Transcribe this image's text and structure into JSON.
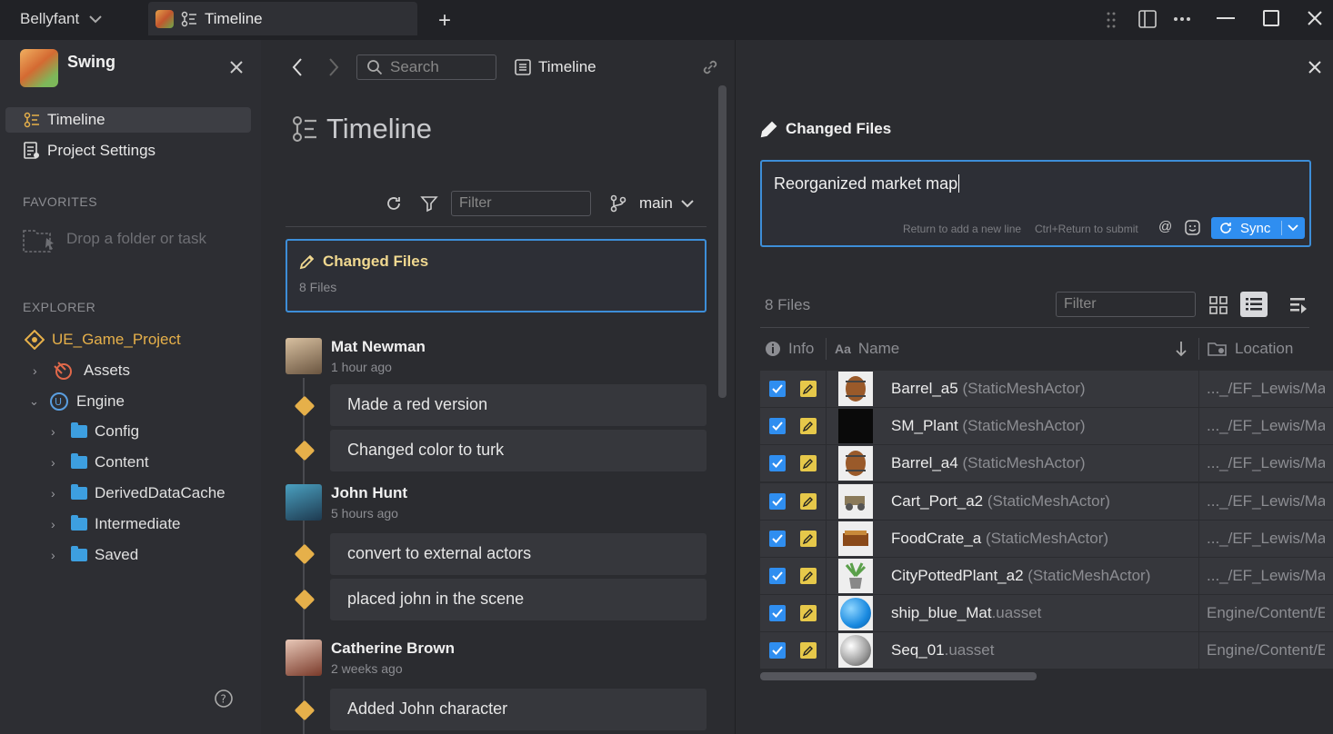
{
  "titlebar": {
    "workspace": "Bellyfant",
    "tab": "Timeline"
  },
  "sidebar": {
    "project": "Swing",
    "nav": [
      {
        "label": "Timeline"
      },
      {
        "label": "Project Settings"
      }
    ],
    "favorites_header": "FAVORITES",
    "favorites_drop": "Drop a folder or task",
    "explorer_header": "EXPLORER",
    "tree": {
      "root": "UE_Game_Project",
      "assets": "Assets",
      "engine": "Engine",
      "folders": [
        "Config",
        "Content",
        "DerivedDataCache",
        "Intermediate",
        "Saved"
      ]
    }
  },
  "middle": {
    "search_placeholder": "Search",
    "breadcrumb": "Timeline",
    "title": "Timeline",
    "filter_placeholder": "Filter",
    "branch": "main",
    "changed": {
      "title": "Changed Files",
      "count": "8 Files"
    },
    "authors": [
      {
        "name": "Mat Newman",
        "time": "1 hour ago",
        "commits": [
          "Made a red version",
          "Changed color to turk"
        ]
      },
      {
        "name": "John Hunt",
        "time": "5 hours ago",
        "commits": [
          "convert to external actors",
          "placed john in the scene"
        ]
      },
      {
        "name": "Catherine Brown",
        "time": "2 weeks ago",
        "commits": [
          "Added John character"
        ]
      }
    ]
  },
  "right": {
    "title": "Changed Files",
    "message": "Reorganized market map",
    "hint_newline": "Return to add a new line",
    "hint_submit": "Ctrl+Return to submit",
    "sync_label": "Sync",
    "files_count": "8 Files",
    "filter_placeholder": "Filter",
    "columns": {
      "info": "Info",
      "name": "Name",
      "location": "Location"
    },
    "files": [
      {
        "name": "Barrel_a5",
        "type": " (StaticMeshActor)",
        "location": "..._/EF_Lewis/Map"
      },
      {
        "name": "SM_Plant",
        "type": " (StaticMeshActor)",
        "location": "..._/EF_Lewis/Ma"
      },
      {
        "name": "Barrel_a4",
        "type": " (StaticMeshActor)",
        "location": "..._/EF_Lewis/Map"
      },
      {
        "name": "Cart_Port_a2",
        "type": " (StaticMeshActor)",
        "location": "..._/EF_Lewis/Map"
      },
      {
        "name": "FoodCrate_a",
        "type": " (StaticMeshActor)",
        "location": "..._/EF_Lewis/Map"
      },
      {
        "name": "CityPottedPlant_a2",
        "type": " (StaticMeshActor)",
        "location": "..._/EF_Lewis/Map"
      },
      {
        "name": "ship_blue_Mat",
        "type": ".uasset",
        "location": "Engine/Content/E"
      },
      {
        "name": "Seq_01",
        "type": ".uasset",
        "location": "Engine/Content/E"
      }
    ]
  },
  "colors": {
    "accent": "#3d8ed8",
    "commit_marker": "#e6b04a",
    "folder": "#3d9fe0"
  }
}
